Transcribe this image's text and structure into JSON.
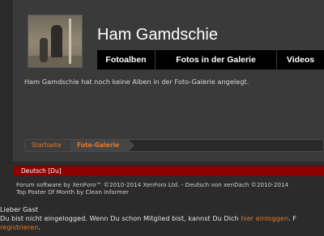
{
  "profile": {
    "username": "Ham Gamdschie",
    "tabs": [
      {
        "label": "Fotoalben"
      },
      {
        "label": "Fotos in der Galerie"
      },
      {
        "label": "Videos"
      }
    ],
    "message": "Ham Gamdschie hat noch keine Alben in der Foto-Galerie angelegt."
  },
  "breadcrumb": {
    "items": [
      {
        "label": "Startseite"
      },
      {
        "label": "Foto-Galerie"
      }
    ]
  },
  "language": {
    "label": "Deutsch [Du]"
  },
  "footer": {
    "line1": "Forum software by XenForo™ ©2010-2014 XenForo Ltd. - Deutsch von xenDach ©2010-2014",
    "line2": "Top Poster Of Month by Clean Informer"
  },
  "guest": {
    "greeting": "Lieber Gast",
    "text_before": "Du bist nicht eingelogged. Wenn Du schon Mitglied bist, kannst Du Dich ",
    "login_link": "hier einloggen",
    "text_after": ". F",
    "register_link": "registrieren",
    "text_end": "."
  },
  "colors": {
    "accent": "#e07a2a",
    "language_bar": "#8b0000",
    "tab_bar": "#000000",
    "background": "#2b2b2b"
  }
}
